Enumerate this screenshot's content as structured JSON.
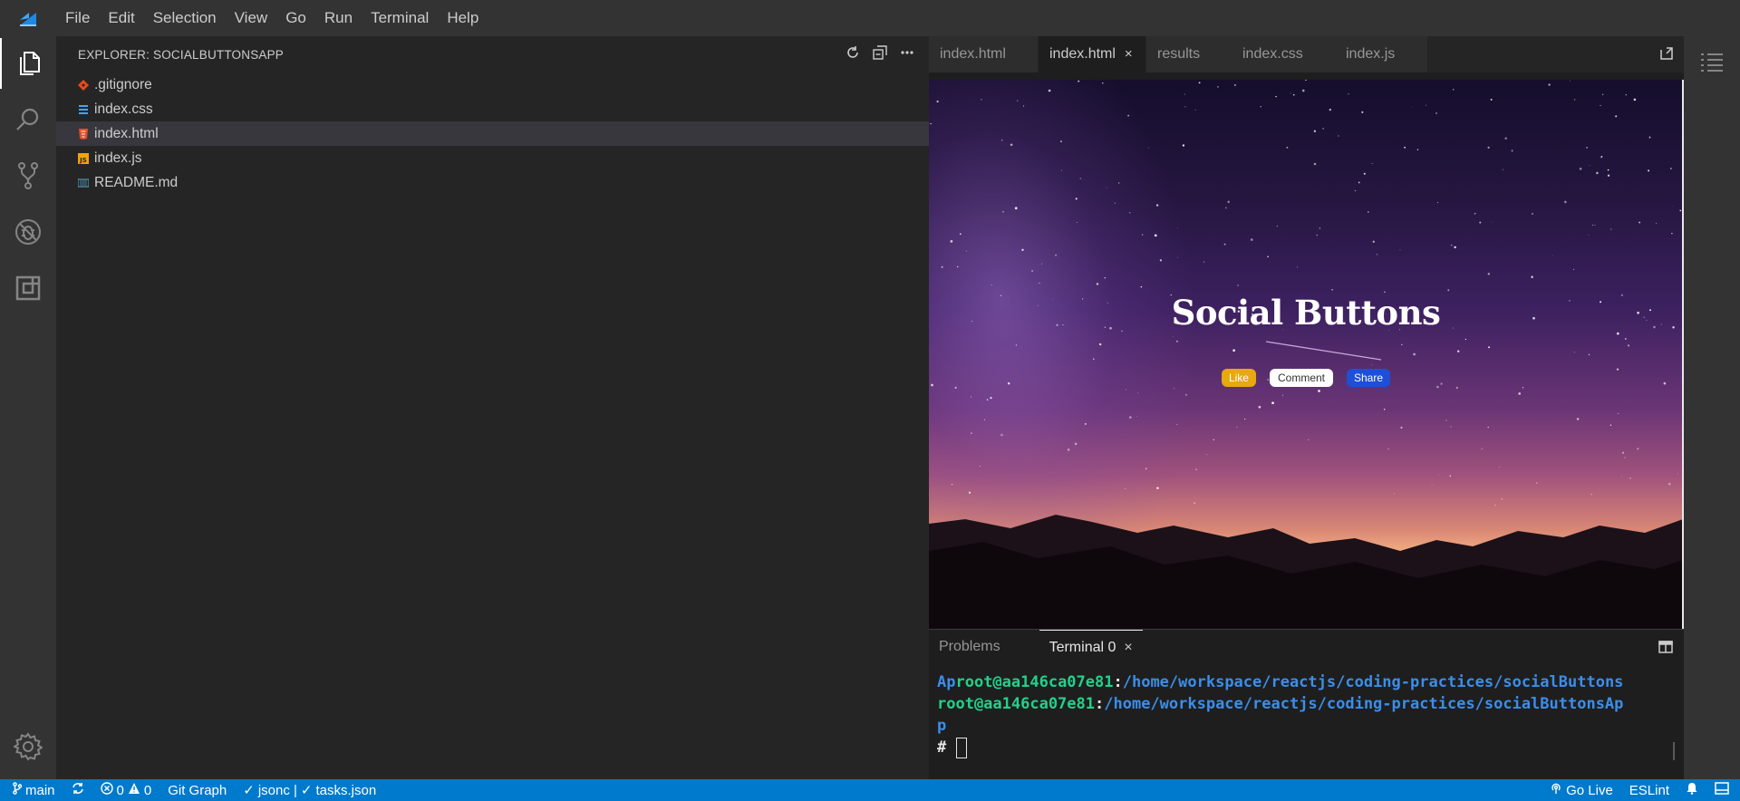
{
  "menu": {
    "items": [
      "File",
      "Edit",
      "Selection",
      "View",
      "Go",
      "Run",
      "Terminal",
      "Help"
    ]
  },
  "activity_bar": {
    "icons": [
      "files-icon",
      "search-icon",
      "source-control-icon",
      "debug-icon",
      "extensions-icon",
      "gear-icon"
    ],
    "active": "files-icon"
  },
  "explorer": {
    "title": "EXPLORER: SOCIALBUTTONSAPP",
    "files": [
      {
        "name": ".gitignore",
        "icon": "git-file-icon",
        "selected": false
      },
      {
        "name": "index.css",
        "icon": "css-file-icon",
        "selected": false
      },
      {
        "name": "index.html",
        "icon": "html-file-icon",
        "selected": true
      },
      {
        "name": "index.js",
        "icon": "js-file-icon",
        "selected": false
      },
      {
        "name": "README.md",
        "icon": "markdown-file-icon",
        "selected": false
      }
    ]
  },
  "editor": {
    "tabs": [
      {
        "label": "index.html",
        "active": false
      },
      {
        "label": "index.html",
        "active": true,
        "close": "×"
      },
      {
        "label": "results",
        "active": false
      },
      {
        "label": "index.css",
        "active": false
      },
      {
        "label": "index.js",
        "active": false
      }
    ]
  },
  "preview": {
    "title": "Social Buttons",
    "buttons": {
      "like": "Like",
      "comment": "Comment",
      "share": "Share"
    }
  },
  "panel": {
    "tabs": [
      {
        "label": "Problems",
        "active": false
      },
      {
        "label": "Terminal 0",
        "active": true,
        "close": "×"
      }
    ],
    "terminal": {
      "line1_prefix": "Ap",
      "user_host": "root@aa146ca07e81",
      "sep": ":",
      "line1_path": "/home/workspace/reactjs/coding-practices/socialButtons",
      "line2_path": "/home/workspace/reactjs/coding-practices/socialButtonsAp",
      "line3": "p",
      "prompt": "#"
    }
  },
  "status": {
    "branch": "main",
    "errors": "0",
    "warnings": "0",
    "git_graph": "Git Graph",
    "jsonc": "jsonc |",
    "tasks": "tasks.json",
    "go_live": "Go Live",
    "eslint": "ESLint"
  },
  "colors": {
    "statusbar": "#007acc",
    "like_button": "#e8a80f",
    "share_button": "#1e4fd8",
    "terminal_user": "#23d18b",
    "terminal_path": "#3b8eea"
  }
}
